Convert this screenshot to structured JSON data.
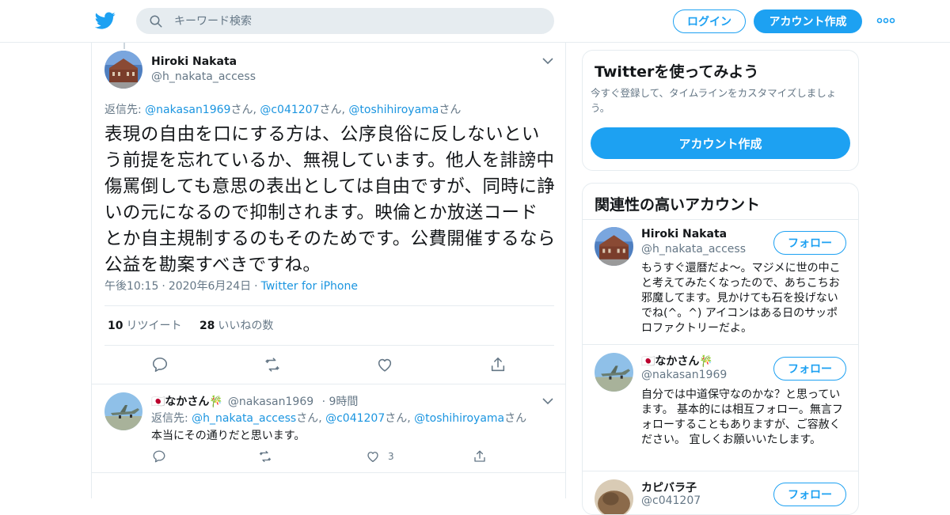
{
  "header": {
    "search_placeholder": "キーワード検索",
    "login_label": "ログイン",
    "signup_label": "アカウント作成",
    "logo_icon": "twitter-bird-icon",
    "more_icon": "more-dots-icon",
    "accent_color": "#1da1f2"
  },
  "tweet": {
    "name": "Hiroki Nakata",
    "handle": "@h_nakata_access",
    "reply_prefix": "返信先:",
    "reply_users": [
      "@nakasan1969",
      "@c041207",
      "@toshihiroyama"
    ],
    "reply_suffix": "さん",
    "text": "表現の自由を口にする方は、公序良俗に反しないという前提を忘れているか、無視しています。他人を誹謗中傷罵倒しても意思の表出としては自由ですが、同時に諍いの元になるので抑制されます。映倫とか放送コードとか自主規制するのもそのためです。公費開催するなら公益を勘案すべきですね。",
    "time": "午後10:15",
    "date": "2020年6月24日",
    "source": "Twitter for iPhone",
    "retweets": "10",
    "retweets_label": "リツイート",
    "likes": "28",
    "likes_label": "いいねの数"
  },
  "reply": {
    "name": "🇯🇵なかさん🎋",
    "handle": "@nakasan1969",
    "time_ago": "9時間",
    "reply_prefix": "返信先:",
    "reply_users": [
      "@h_nakata_access",
      "@c041207",
      "@toshihiroyama"
    ],
    "reply_suffix": "さん",
    "text": "本当にその通りだと思います。",
    "like_count": "3"
  },
  "signup_card": {
    "title": "Twitterを使ってみよう",
    "desc": "今すぐ登録して、タイムラインをカスタマイズしましょう。",
    "button": "アカウント作成"
  },
  "related": {
    "title": "関連性の高いアカウント",
    "follow_label": "フォロー",
    "accounts": [
      {
        "name": "Hiroki Nakata",
        "handle": "@h_nakata_access",
        "bio": "もうすぐ還暦だよ〜。マジメに世の中こと考えてみたくなったので、あちこちお邪魔してます。見かけても石を投げないでね(^。^) アイコンはある日のサッポロファクトリーだよ。"
      },
      {
        "name": "🇯🇵なかさん🎋",
        "handle": "@nakasan1969",
        "bio": "自分では中道保守なのかな？と思っています。 基本的には相互フォロー。無言フォローすることもありますが、ご容赦ください。 宜しくお願いいたします。"
      },
      {
        "name": "カピバラ子",
        "handle": "@c041207",
        "bio": ""
      }
    ]
  }
}
